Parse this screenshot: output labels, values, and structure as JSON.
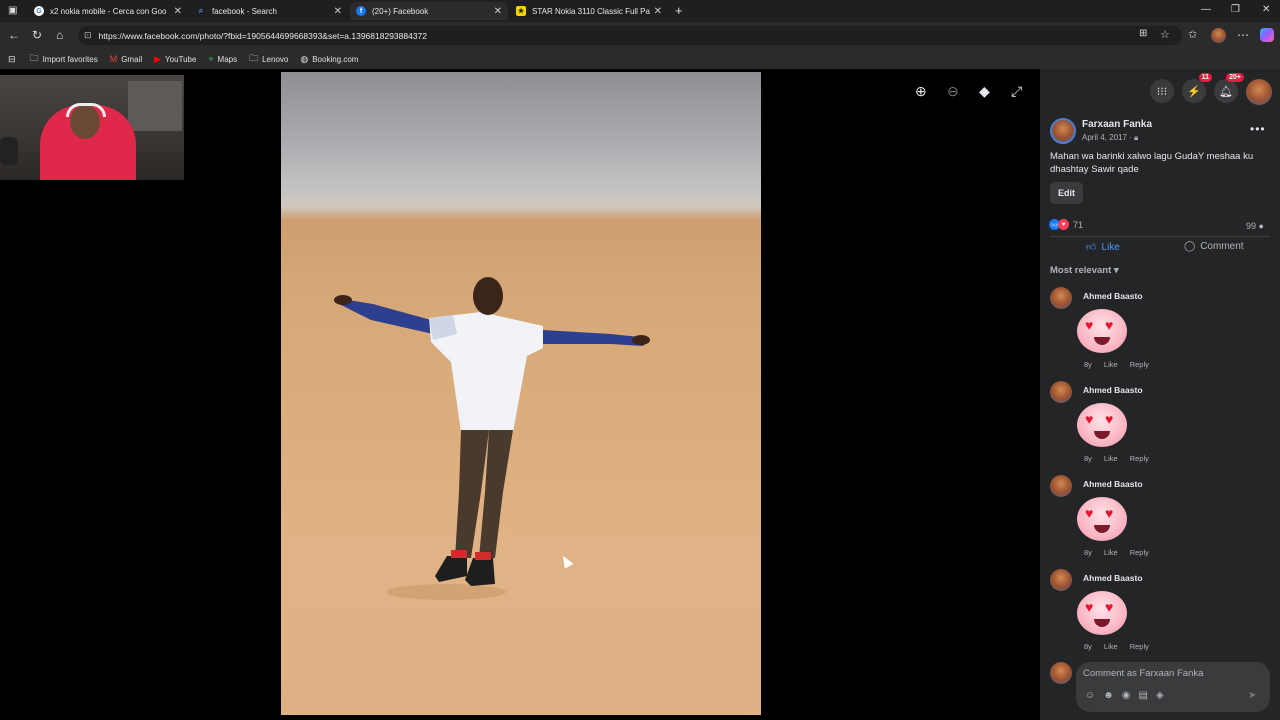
{
  "browser": {
    "tabs": [
      {
        "title": "x2 nokia mobile - Cerca con Goo",
        "icon": "google-icon",
        "color": "#ffffff"
      },
      {
        "title": "facebook - Search",
        "icon": "search-icon",
        "color": "#4a90e2"
      },
      {
        "title": "(20+) Facebook",
        "icon": "facebook-icon",
        "color": "#1877f2"
      },
      {
        "title": "STAR Nokia 3110 Classic Full Pan",
        "icon": "star-icon",
        "color": "#f5d300"
      }
    ],
    "close_glyph": "✕",
    "new_tab_glyph": "+",
    "url": "https://www.facebook.com/photo/?fbid=1905644699668393&set=a.1396818293884372",
    "bookmarks": [
      {
        "label": "Import favorites",
        "icon": "folder-icon"
      },
      {
        "label": "Gmail",
        "icon": "gmail-icon"
      },
      {
        "label": "YouTube",
        "icon": "youtube-icon"
      },
      {
        "label": "Maps",
        "icon": "maps-icon"
      },
      {
        "label": "Lenovo",
        "icon": "folder-icon"
      },
      {
        "label": "Booking.com",
        "icon": "globe-icon"
      }
    ]
  },
  "post": {
    "author": "Farxaan Fanka",
    "date": "April 4, 2017 · ",
    "caption": "Mahan wa barinki xalwo lagu GudaY meshaa ku dhashtay Sawir qade",
    "edit_label": "Edit",
    "reaction_count": "71",
    "comment_count": "99",
    "like_label": "Like",
    "comment_label": "Comment",
    "sort_label": "Most relevant",
    "accent_color": "#4599ff"
  },
  "notifications": {
    "messenger_badge": "11",
    "bell_badge": "20+"
  },
  "comments": [
    {
      "name": "Ahmed Baasto",
      "time": "8y",
      "like": "Like",
      "reply": "Reply"
    },
    {
      "name": "Ahmed Baasto",
      "time": "8y",
      "like": "Like",
      "reply": "Reply"
    },
    {
      "name": "Ahmed Baasto",
      "time": "8y",
      "like": "Like",
      "reply": "Reply"
    },
    {
      "name": "Ahmed Baasto",
      "time": "8y",
      "like": "Like",
      "reply": "Reply"
    }
  ],
  "composer": {
    "placeholder": "Comment as Farxaan Fanka"
  }
}
